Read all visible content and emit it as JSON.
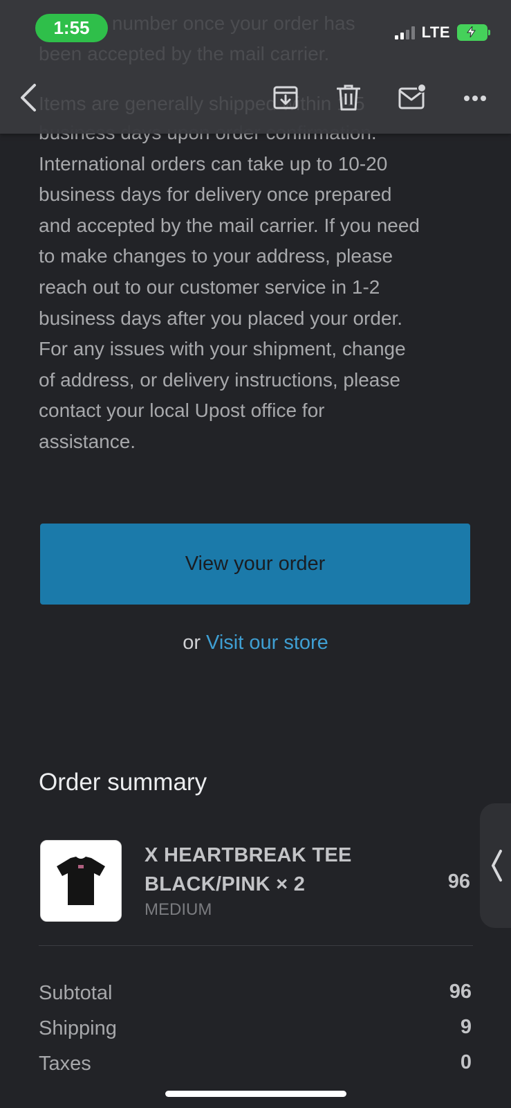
{
  "status_bar": {
    "time": "1:55",
    "network": "LTE",
    "colors": {
      "time_pill": "#2fbf4a",
      "battery": "#45d15a"
    }
  },
  "toolbar": {
    "icons": [
      "back-icon",
      "archive-icon",
      "trash-icon",
      "mark-unread-icon",
      "more-icon"
    ]
  },
  "email": {
    "body_lines": [
      "business days upon order confirmation.",
      "International orders can take up to 10-20",
      "business days for delivery once prepared",
      "and accepted by the mail carrier. If you need",
      "to make changes to your address, please",
      "reach out to our customer service in 1-2",
      "business days after you placed your order.",
      "For any issues with your shipment, change",
      "of address, or delivery instructions, please",
      "contact your local Upost office for",
      "assistance."
    ],
    "hidden_lines": [
      "tracking number once your order has",
      "been accepted by the mail carrier.",
      "Items are generally shipped within 1-5"
    ],
    "cta_button": "View your order",
    "or_text": "or",
    "store_link": "Visit our store",
    "accent_color": "#1b7aaa"
  },
  "order_summary": {
    "heading": "Order summary",
    "item": {
      "name_line1": "X HEARTBREAK TEE",
      "name_line2": "BLACK/PINK × 2",
      "variant": "MEDIUM",
      "price": "96"
    },
    "totals": [
      {
        "label": "Subtotal",
        "value": "96"
      },
      {
        "label": "Shipping",
        "value": "9"
      },
      {
        "label": "Taxes",
        "value": "0"
      }
    ]
  }
}
